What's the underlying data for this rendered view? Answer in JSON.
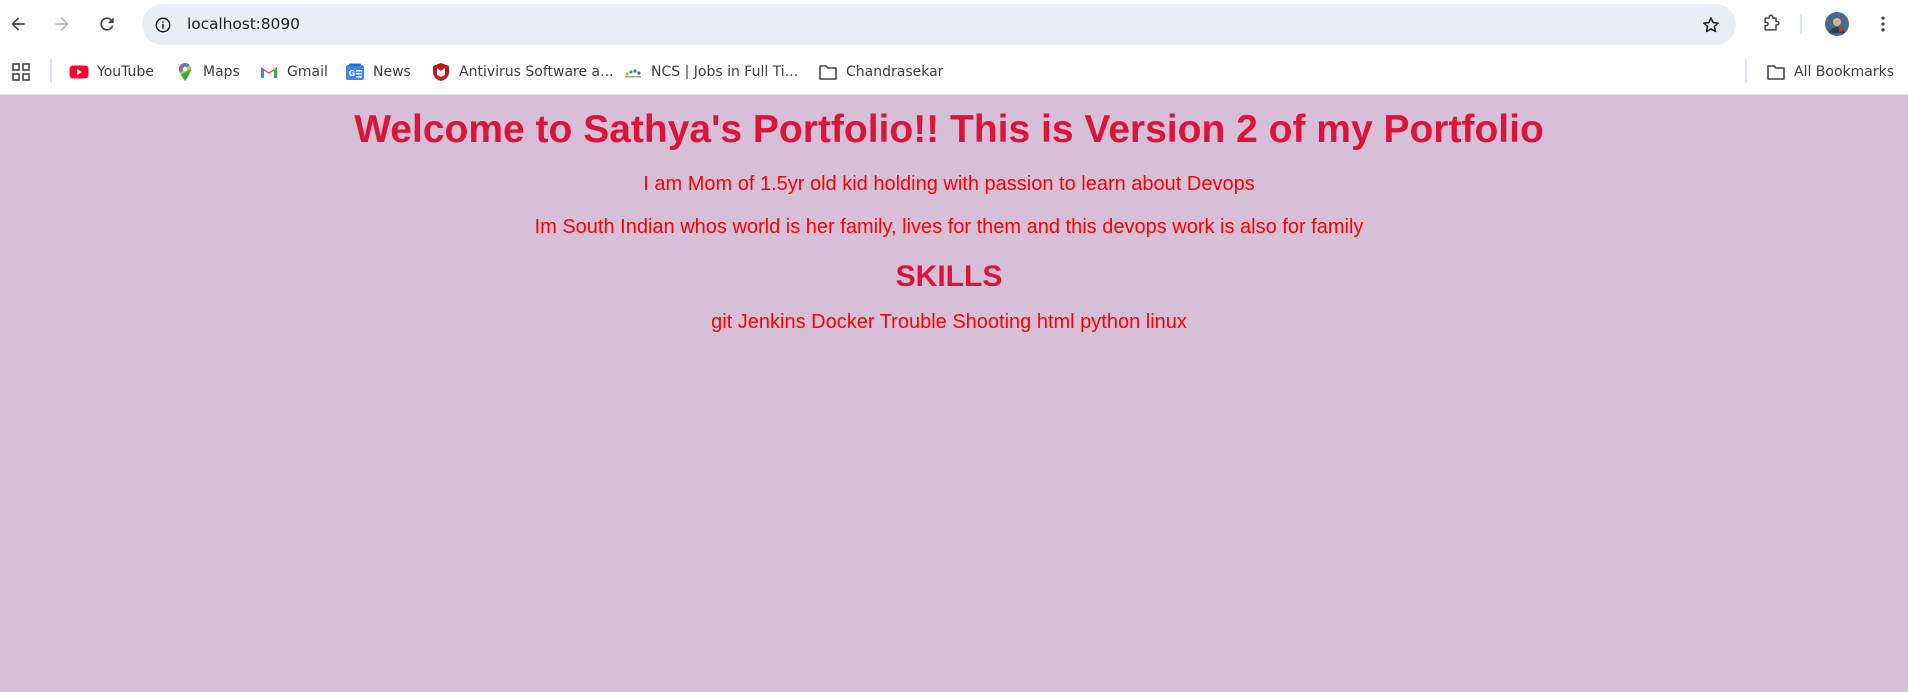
{
  "browser": {
    "url": "localhost:8090",
    "nav_icons": [
      "back-icon",
      "forward-icon",
      "reload-icon"
    ],
    "accent_color": "#e9eef6"
  },
  "bookmarks": {
    "items": [
      {
        "label": "YouTube",
        "icon": "youtube-icon"
      },
      {
        "label": "Maps",
        "icon": "maps-icon"
      },
      {
        "label": "Gmail",
        "icon": "gmail-icon"
      },
      {
        "label": "News",
        "icon": "news-icon"
      },
      {
        "label": "Antivirus Software a...",
        "icon": "mcafee-icon"
      },
      {
        "label": "NCS | Jobs in Full Ti...",
        "icon": "ncs-icon"
      },
      {
        "label": "Chandrasekar",
        "icon": "folder-icon"
      }
    ],
    "all_bookmarks": "All Bookmarks"
  },
  "page": {
    "background": "#d8bfd8",
    "heading": "Welcome to Sathya's Portfolio!! This is Version 2 of my Portfolio",
    "intro1": "I am Mom of 1.5yr old kid holding with passion to learn about Devops",
    "intro2": "Im South Indian whos world is her family, lives for them and this devops work is also for family",
    "skills_heading": "SKILLS",
    "skills": "git Jenkins Docker Trouble Shooting html python linux",
    "heading_color": "#dc143c",
    "text_color": "#ff0000"
  }
}
